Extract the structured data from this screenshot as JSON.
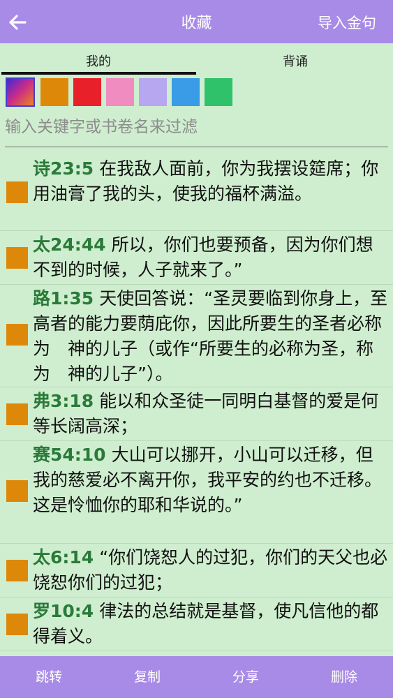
{
  "header": {
    "title": "收藏",
    "import_label": "导入金句"
  },
  "tabs": [
    {
      "label": "我的",
      "active": true
    },
    {
      "label": "背诵",
      "active": false
    }
  ],
  "colors": {
    "accent": "#a88be6",
    "background": "#cfeecf",
    "reference": "#2a7a3a",
    "marker": "#dd8809",
    "swatches": [
      "gradient",
      "#dd8809",
      "#e8202a",
      "#f08cc0",
      "#b7a6f0",
      "#3a9be6",
      "#2fc26a"
    ]
  },
  "filter": {
    "placeholder": "输入关键字或书卷名来过滤",
    "value": ""
  },
  "verses": [
    {
      "ref": "诗23:5",
      "text": "在我敌人面前，你为我摆设筵席；你用油膏了我的头，使我的福杯满溢。"
    },
    {
      "ref": "太24:44",
      "text": "所以，你们也要预备，因为你们想不到的时候，人子就来了。”"
    },
    {
      "ref": "路1:35",
      "text": "天使回答说：“圣灵要临到你身上，至高者的能力要荫庇你，因此所要生的圣者必称为　神的儿子（或作“所要生的必称为圣，称为　神的儿子”）。"
    },
    {
      "ref": "弗3:18",
      "text": "能以和众圣徒一同明白基督的爱是何等长阔高深；"
    },
    {
      "ref": "赛54:10",
      "text": "大山可以挪开，小山可以迁移，但我的慈爱必不离开你，我平安的约也不迁移。这是怜恤你的耶和华说的。”"
    },
    {
      "ref": "太6:14",
      "text": "“你们饶恕人的过犯，你们的天父也必饶恕你们的过犯；"
    },
    {
      "ref": "罗10:4",
      "text": "律法的总结就是基督，使凡信他的都得着义。"
    }
  ],
  "actions": {
    "jump": "跳转",
    "copy": "复制",
    "share": "分享",
    "delete": "删除"
  }
}
